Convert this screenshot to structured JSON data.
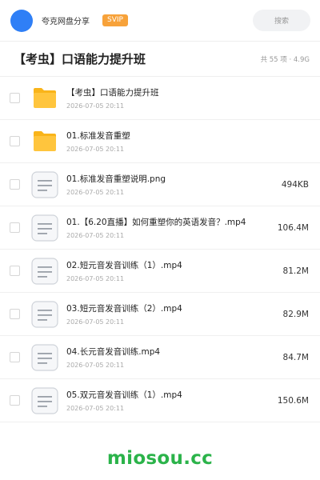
{
  "header": {
    "share_name": "夸克网盘分享",
    "badge": "SVIP",
    "search_placeholder": "搜索"
  },
  "folder": {
    "title": "【考虫】口语能力提升班",
    "meta": "共 55 项 · 4.9G"
  },
  "files": [
    {
      "type": "folder",
      "name": "【考虫】口语能力提升班",
      "date": "2026-07-05 20:11",
      "size": ""
    },
    {
      "type": "folder",
      "name": "01.标准发音重塑",
      "date": "2026-07-05 20:11",
      "size": ""
    },
    {
      "type": "file",
      "name": "01.标准发音重塑说明.png",
      "date": "2026-07-05 20:11",
      "size": "494KB"
    },
    {
      "type": "file",
      "name": "01.【6.20直播】如何重塑你的英语发音？.mp4",
      "date": "2026-07-05 20:11",
      "size": "106.4M"
    },
    {
      "type": "file",
      "name": "02.短元音发音训练（1）.mp4",
      "date": "2026-07-05 20:11",
      "size": "81.2M"
    },
    {
      "type": "file",
      "name": "03.短元音发音训练（2）.mp4",
      "date": "2026-07-05 20:11",
      "size": "82.9M"
    },
    {
      "type": "file",
      "name": "04.长元音发音训练.mp4",
      "date": "2026-07-05 20:11",
      "size": "84.7M"
    },
    {
      "type": "file",
      "name": "05.双元音发音训练（1）.mp4",
      "date": "2026-07-05 20:11",
      "size": "150.6M"
    }
  ],
  "watermark": "miosou.cc",
  "colors": {
    "avatar": "#2f7ff6",
    "svip_badge": "#f7a23a",
    "folder_icon": "#ffc53d",
    "watermark": "#2bb34a"
  }
}
